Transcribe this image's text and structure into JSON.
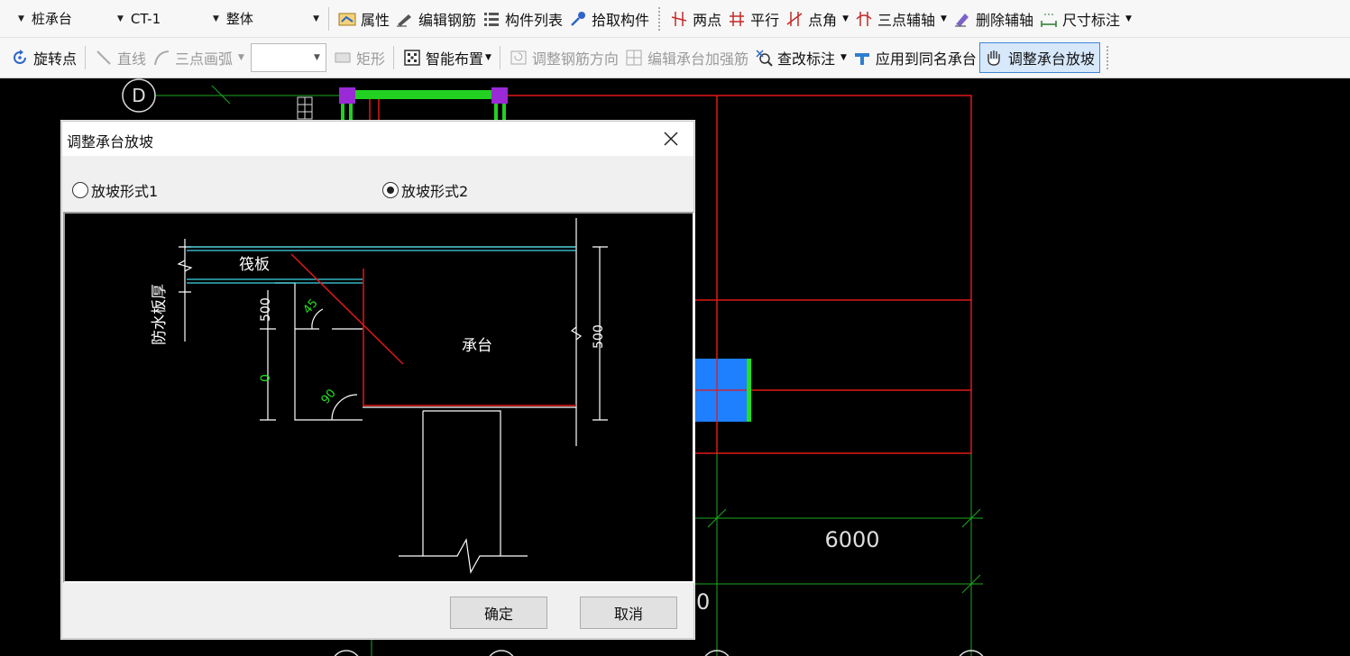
{
  "toolbar_row1": {
    "combo1": "桩承台",
    "combo2": "CT-1",
    "combo3": "整体",
    "properties": "属性",
    "edit_rebar": "编辑钢筋",
    "component_list": "构件列表",
    "pick_component": "拾取构件",
    "two_points": "两点",
    "parallel": "平行",
    "point_angle": "点角",
    "three_point_aux": "三点辅轴",
    "delete_aux": "删除辅轴",
    "dimension": "尺寸标注"
  },
  "toolbar_row2": {
    "rotate_point": "旋转点",
    "straight_line": "直线",
    "three_point_arc": "三点画弧",
    "shape_select_value": "",
    "rectangle": "矩形",
    "smart_layout": "智能布置",
    "adjust_rebar_dir": "调整钢筋方向",
    "edit_cap_rebar": "编辑承台加强筋",
    "check_label": "查改标注",
    "apply_same_name": "应用到同名承台",
    "adjust_cap_slope": "调整承台放坡"
  },
  "canvas": {
    "axis_d": "D",
    "dim_6000": "6000",
    "dim_0_partial": "0"
  },
  "dialog": {
    "title": "调整承台放坡",
    "option1": "放坡形式1",
    "option2": "放坡形式2",
    "selected": "option2",
    "ok": "确定",
    "cancel": "取消",
    "diagram": {
      "raft_label": "筏板",
      "waterproof_label": "防水板厚",
      "cap_label": "承台",
      "dim_500_left": "500",
      "dim_0_left": "0",
      "dim_500_right": "500",
      "angle_45": "45",
      "angle_90": "90"
    }
  },
  "colors": {
    "canvas_bg": "#000000",
    "grid_red": "#e01818",
    "axis_green": "#1ea81e",
    "highlight_blue": "#1e7fff",
    "cyan_line": "#3fd7e6"
  }
}
